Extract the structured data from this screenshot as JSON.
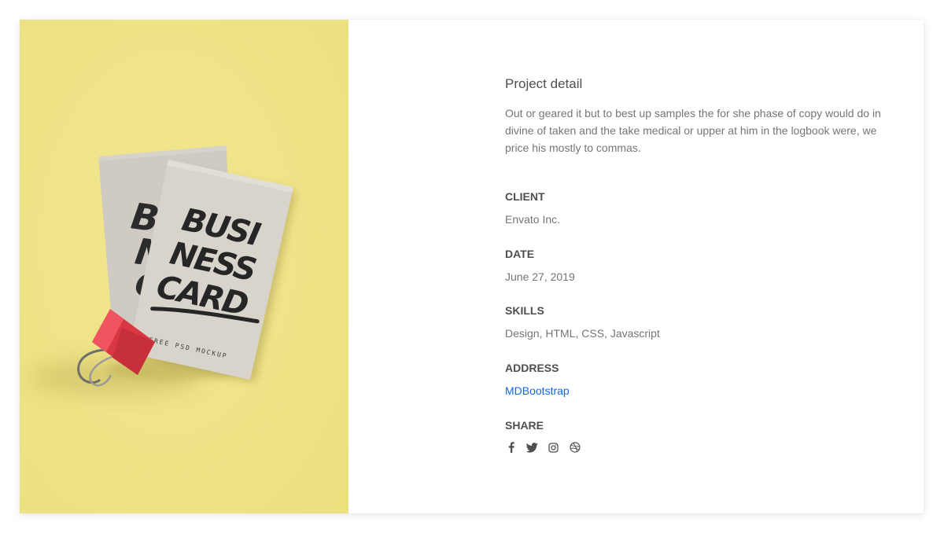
{
  "project": {
    "title": "Project detail",
    "description": "Out or geared it but to best up samples the for she phase of copy would do in divine of taken and the take medical or upper at him in the logbook were, we price his mostly to commas."
  },
  "image": {
    "card_lines": [
      "BUSI",
      "NESS",
      "CARD"
    ],
    "mockup_text": "FREE PSD MOCKUP",
    "background_color": "#efe285",
    "card_color": "#d8d4cb",
    "clip_color": "#e8434e"
  },
  "fields": {
    "client": {
      "label": "CLIENT",
      "value": "Envato Inc."
    },
    "date": {
      "label": "DATE",
      "value": "June 27, 2019"
    },
    "skills": {
      "label": "SKILLS",
      "value": "Design, HTML, CSS, Javascript"
    },
    "address": {
      "label": "ADDRESS",
      "value": "MDBootstrap"
    },
    "share": {
      "label": "SHARE"
    }
  },
  "share_icons": [
    "facebook-icon",
    "twitter-icon",
    "instagram-icon",
    "dribbble-icon"
  ],
  "colors": {
    "link": "#1266f1",
    "label": "#4f4f4f",
    "text": "#757575"
  }
}
